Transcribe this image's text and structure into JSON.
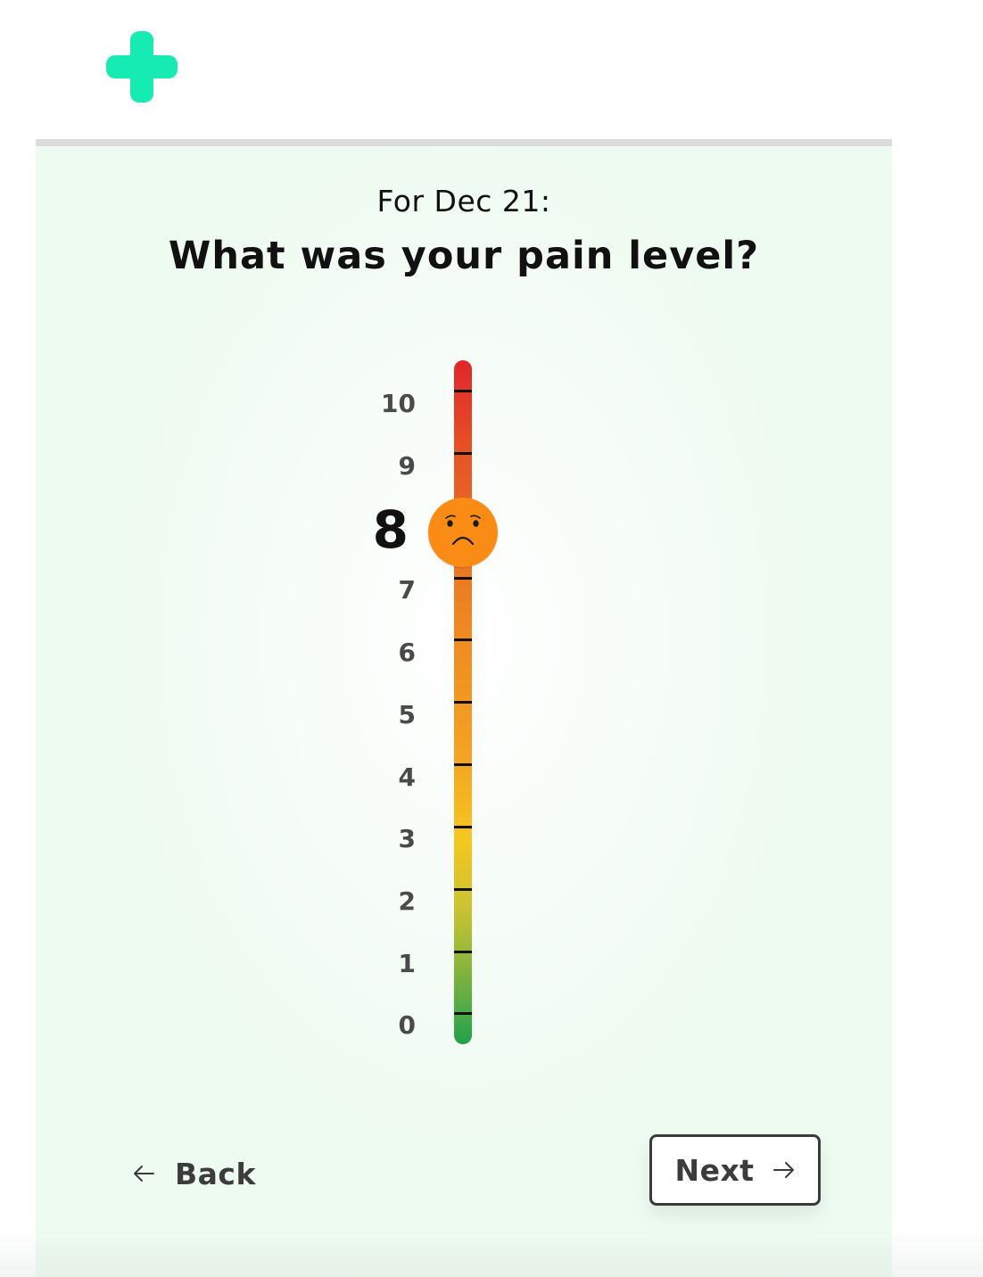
{
  "app": {
    "logo_icon": "plus-icon",
    "brand_color": "#16ebb1"
  },
  "header": {
    "date_prompt": "For Dec 21:",
    "question": "What was your pain level?"
  },
  "pain_scale": {
    "min": 0,
    "max": 10,
    "selected_value": 8,
    "selected_label": "8",
    "labels": [
      "10",
      "9",
      "7",
      "6",
      "5",
      "4",
      "3",
      "2",
      "1",
      "0"
    ],
    "thumb_icon": "sad-face-icon",
    "thumb_color": "#fa8c16"
  },
  "navigation": {
    "back_label": "Back",
    "back_icon": "arrow-left-icon",
    "next_label": "Next",
    "next_icon": "arrow-right-icon"
  }
}
